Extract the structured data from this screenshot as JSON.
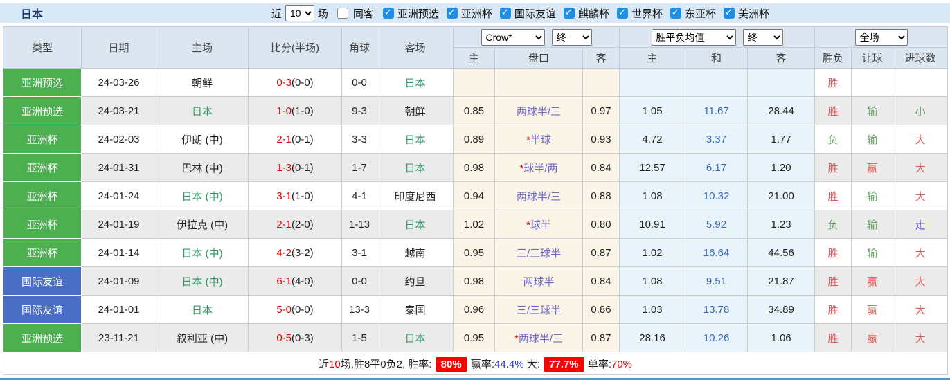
{
  "header_bar": {
    "title": "日本",
    "recent_label": "近",
    "recent_value": "10",
    "matches_label": "场",
    "same_venue": {
      "label": "同客",
      "checked": false
    },
    "competitions": [
      {
        "label": "亚洲预选",
        "checked": true
      },
      {
        "label": "亚洲杯",
        "checked": true
      },
      {
        "label": "国际友谊",
        "checked": true
      },
      {
        "label": "麒麟杯",
        "checked": true
      },
      {
        "label": "世界杯",
        "checked": true
      },
      {
        "label": "东亚杯",
        "checked": true
      },
      {
        "label": "美洲杯",
        "checked": true
      }
    ]
  },
  "table": {
    "headers": {
      "type": "类型",
      "date": "日期",
      "home": "主场",
      "score": "比分(半场)",
      "corners": "角球",
      "away": "客场",
      "sub_home": "主",
      "sub_handicap": "盘口",
      "sub_away": "客",
      "sub_avg_home": "主",
      "sub_avg_draw": "和",
      "sub_avg_away": "客",
      "sub_wdl": "胜负",
      "sub_let": "让球",
      "sub_goals": "进球数"
    },
    "selects": {
      "odds_company": "Crow*",
      "odds_time_1": "终",
      "avg_label": "胜平负均值",
      "odds_time_2": "终",
      "scope": "全场"
    },
    "rows": [
      {
        "type": "亚洲预选",
        "badge": "green",
        "date": "24-03-26",
        "home": "朝鲜",
        "homeGreen": false,
        "ft": "0-3",
        "ht": "(0-0)",
        "corners": "0-0",
        "away": "日本",
        "awayGreen": true,
        "oH": "",
        "star": "",
        "hc": "",
        "oA": "",
        "aH": "",
        "aD": "",
        "aA": "",
        "r1": "胜",
        "r1c": "red",
        "r2": "",
        "r2c": "",
        "r3": "",
        "r3c": ""
      },
      {
        "type": "亚洲预选",
        "badge": "green",
        "date": "24-03-21",
        "home": "日本",
        "homeGreen": true,
        "ft": "1-0",
        "ht": "(1-0)",
        "corners": "9-3",
        "away": "朝鲜",
        "awayGreen": false,
        "oH": "0.85",
        "star": "",
        "hc": "两球半/三",
        "oA": "0.97",
        "aH": "1.05",
        "aD": "11.67",
        "aA": "28.44",
        "r1": "胜",
        "r1c": "red",
        "r2": "输",
        "r2c": "green",
        "r3": "小",
        "r3c": "green"
      },
      {
        "type": "亚洲杯",
        "badge": "green",
        "date": "24-02-03",
        "home": "伊朗 (中)",
        "homeGreen": false,
        "ft": "2-1",
        "ht": "(0-1)",
        "corners": "3-3",
        "away": "日本",
        "awayGreen": true,
        "oH": "0.89",
        "star": "*",
        "hc": "半球",
        "oA": "0.93",
        "aH": "4.72",
        "aD": "3.37",
        "aA": "1.77",
        "r1": "负",
        "r1c": "green",
        "r2": "输",
        "r2c": "green",
        "r3": "大",
        "r3c": "red"
      },
      {
        "type": "亚洲杯",
        "badge": "green",
        "date": "24-01-31",
        "home": "巴林 (中)",
        "homeGreen": false,
        "ft": "1-3",
        "ht": "(0-1)",
        "corners": "1-7",
        "away": "日本",
        "awayGreen": true,
        "oH": "0.98",
        "star": "*",
        "hc": "球半/两",
        "oA": "0.84",
        "aH": "12.57",
        "aD": "6.17",
        "aA": "1.20",
        "r1": "胜",
        "r1c": "red",
        "r2": "赢",
        "r2c": "red",
        "r3": "大",
        "r3c": "red"
      },
      {
        "type": "亚洲杯",
        "badge": "green",
        "date": "24-01-24",
        "home": "日本 (中)",
        "homeGreen": true,
        "ft": "3-1",
        "ht": "(1-0)",
        "corners": "4-1",
        "away": "印度尼西",
        "awayGreen": false,
        "oH": "0.94",
        "star": "",
        "hc": "两球半/三",
        "oA": "0.88",
        "aH": "1.08",
        "aD": "10.32",
        "aA": "21.00",
        "r1": "胜",
        "r1c": "red",
        "r2": "输",
        "r2c": "green",
        "r3": "大",
        "r3c": "red"
      },
      {
        "type": "亚洲杯",
        "badge": "green",
        "date": "24-01-19",
        "home": "伊拉克 (中)",
        "homeGreen": false,
        "ft": "2-1",
        "ht": "(2-0)",
        "corners": "1-13",
        "away": "日本",
        "awayGreen": true,
        "oH": "1.02",
        "star": "*",
        "hc": "球半",
        "oA": "0.80",
        "aH": "10.91",
        "aD": "5.92",
        "aA": "1.23",
        "r1": "负",
        "r1c": "green",
        "r2": "输",
        "r2c": "green",
        "r3": "走",
        "r3c": "purple"
      },
      {
        "type": "亚洲杯",
        "badge": "green",
        "date": "24-01-14",
        "home": "日本 (中)",
        "homeGreen": true,
        "ft": "4-2",
        "ht": "(3-2)",
        "corners": "3-1",
        "away": "越南",
        "awayGreen": false,
        "oH": "0.95",
        "star": "",
        "hc": "三/三球半",
        "oA": "0.87",
        "aH": "1.02",
        "aD": "16.64",
        "aA": "44.56",
        "r1": "胜",
        "r1c": "red",
        "r2": "输",
        "r2c": "green",
        "r3": "大",
        "r3c": "red"
      },
      {
        "type": "国际友谊",
        "badge": "blue",
        "date": "24-01-09",
        "home": "日本 (中)",
        "homeGreen": true,
        "ft": "6-1",
        "ht": "(4-0)",
        "corners": "0-0",
        "away": "约旦",
        "awayGreen": false,
        "oH": "0.98",
        "star": "",
        "hc": "两球半",
        "oA": "0.84",
        "aH": "1.08",
        "aD": "9.51",
        "aA": "21.87",
        "r1": "胜",
        "r1c": "red",
        "r2": "赢",
        "r2c": "red",
        "r3": "大",
        "r3c": "red"
      },
      {
        "type": "国际友谊",
        "badge": "blue",
        "date": "24-01-01",
        "home": "日本",
        "homeGreen": true,
        "ft": "5-0",
        "ht": "(0-0)",
        "corners": "13-3",
        "away": "泰国",
        "awayGreen": false,
        "oH": "0.96",
        "star": "",
        "hc": "三/三球半",
        "oA": "0.86",
        "aH": "1.03",
        "aD": "13.78",
        "aA": "34.89",
        "r1": "胜",
        "r1c": "red",
        "r2": "赢",
        "r2c": "red",
        "r3": "大",
        "r3c": "red"
      },
      {
        "type": "亚洲预选",
        "badge": "green",
        "date": "23-11-21",
        "home": "叙利亚 (中)",
        "homeGreen": false,
        "ft": "0-5",
        "ht": "(0-3)",
        "corners": "1-5",
        "away": "日本",
        "awayGreen": true,
        "oH": "0.95",
        "star": "*",
        "hc": "两球半/三",
        "oA": "0.87",
        "aH": "28.16",
        "aD": "10.26",
        "aA": "1.06",
        "r1": "胜",
        "r1c": "red",
        "r2": "赢",
        "r2c": "red",
        "r3": "大",
        "r3c": "red"
      }
    ]
  },
  "summary": {
    "prefix": "近",
    "count": "10",
    "record": "场,胜8平0负2, 胜率:",
    "win_rate": "80%",
    "w_label": "赢率:",
    "w_value": "44.4%",
    "big_label": "大:",
    "big_value": "77.7%",
    "single_label": "单率:",
    "single_value": "70%"
  },
  "colors": {
    "badge_green": "#4cb050",
    "badge_blue": "#4a6dc5",
    "japan_green": "#339966",
    "score_red": "#e80000",
    "draw_odds_blue": "#3568b8",
    "handicap_slate": "#716bc8",
    "result_red": "#e05a5a",
    "result_green": "#5d9b5d",
    "result_purple": "#5b4fd6",
    "summary_badge_bg": "#ff0000",
    "bottom_strip": "#3f9fd8",
    "topbar_bg": "#d9e8f7",
    "header_bg": "#dce6f1"
  }
}
